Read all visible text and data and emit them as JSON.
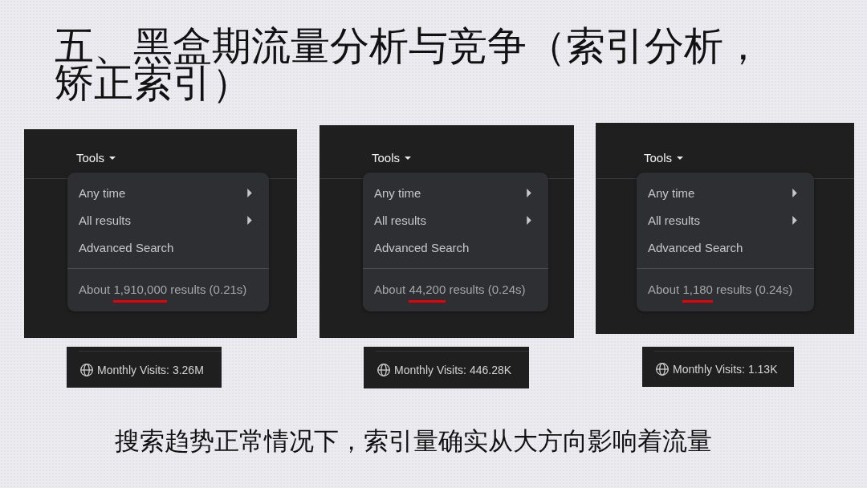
{
  "title": "五、黑盒期流量分析与竞争（索引分析，矫正索引）",
  "screenshots": [
    {
      "tools_label": "Tools",
      "menu_items": [
        {
          "label": "Any time",
          "kind": "submenu"
        },
        {
          "label": "All results",
          "kind": "submenu"
        },
        {
          "label": "Advanced Search",
          "kind": "link"
        }
      ],
      "result_stats": {
        "prefix": "About",
        "count": "1,910,000",
        "suffix": "results (0.21s)",
        "underlined": true
      },
      "monthly_visits": "Monthly Visits: 3.26M"
    },
    {
      "tools_label": "Tools",
      "menu_items": [
        {
          "label": "Any time",
          "kind": "submenu"
        },
        {
          "label": "All results",
          "kind": "submenu"
        },
        {
          "label": "Advanced Search",
          "kind": "link"
        }
      ],
      "result_stats": {
        "prefix": "About",
        "count": "44,200",
        "suffix": "results (0.24s)",
        "underlined": true
      },
      "monthly_visits": "Monthly Visits: 446.28K"
    },
    {
      "tools_label": "Tools",
      "menu_items": [
        {
          "label": "Any time",
          "kind": "submenu"
        },
        {
          "label": "All results",
          "kind": "submenu"
        },
        {
          "label": "Advanced Search",
          "kind": "link"
        }
      ],
      "result_stats": {
        "prefix": "About",
        "count": "1,180",
        "suffix": "results (0.24s)",
        "underlined": true
      },
      "monthly_visits": "Monthly Visits: 1.13K"
    }
  ],
  "caption": "搜索趋势正常情况下，索引量确实从大方向影响着流量"
}
